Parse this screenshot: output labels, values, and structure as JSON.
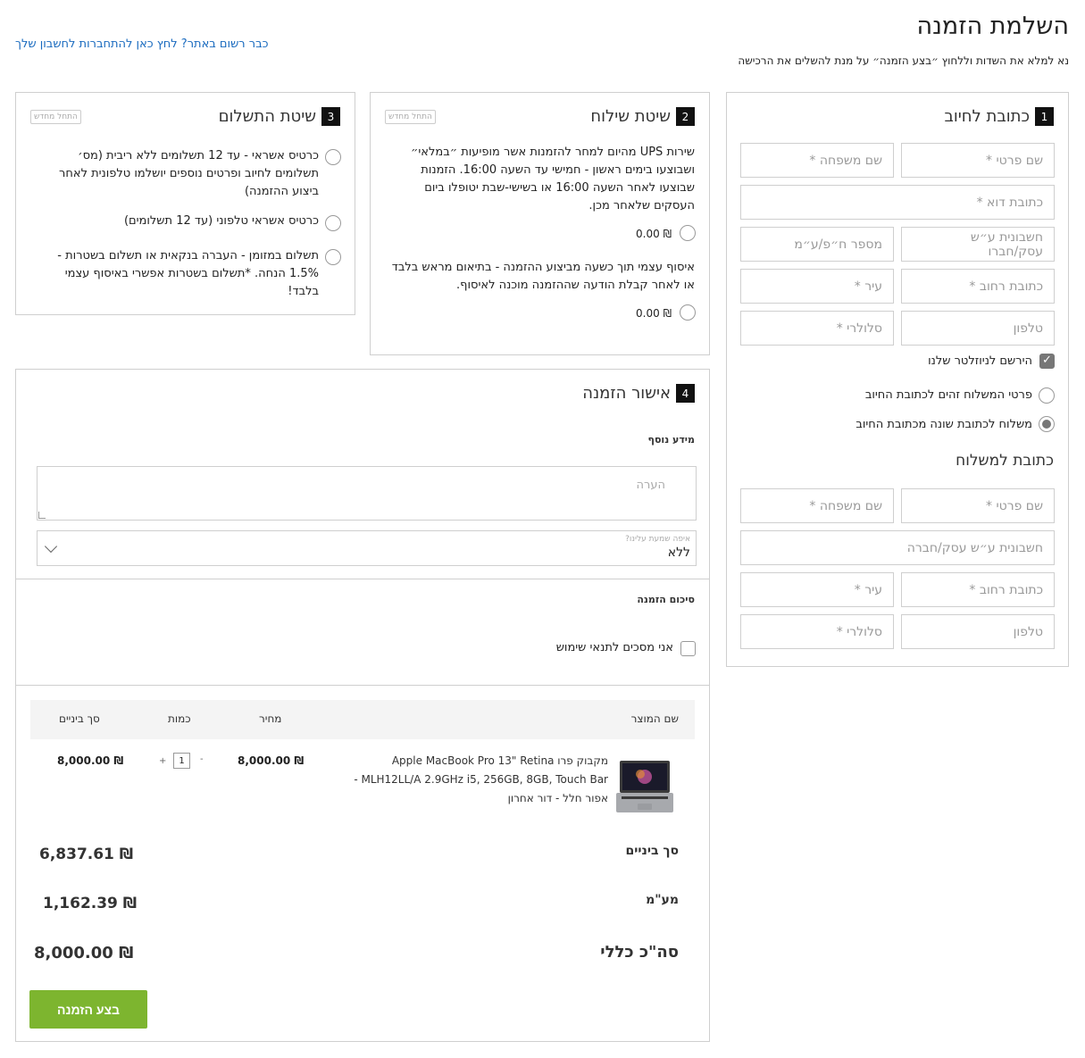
{
  "page": {
    "title": "השלמת הזמנה",
    "subtitle": "נא למלא את השדות וללחוץ ״בצע הזמנה״ על מנת להשלים את הרכישה",
    "login_link": "כבר רשום באתר? לחץ כאן להתחברות לחשבון שלך"
  },
  "billing": {
    "number": "1",
    "title": "כתובת לחיוב",
    "fields": {
      "first_name": "שם פרטי *",
      "last_name": "שם משפחה *",
      "email": "כתובת דוא *",
      "invoice_name": "חשבונית ע״ש עסק/חברו",
      "company_id": "מספר ח״פ/ע״מ",
      "street": "כתובת רחוב *",
      "city": "עיר *",
      "phone": "טלפון",
      "mobile": "סלולרי *"
    },
    "newsletter": "הירשם לניוזלטר שלנו",
    "newsletter_checked": true,
    "ship_same": "פרטי המשלוח זהים לכתובת החיוב",
    "ship_different": "משלוח לכתובת שונה מכתובת החיוב",
    "ship_choice": "different"
  },
  "shipping_address": {
    "title": "כתובת למשלוח",
    "fields": {
      "first_name": "שם פרטי *",
      "last_name": "שם משפחה *",
      "invoice_name": "חשבונית ע״ש עסק/חברה",
      "street": "כתובת רחוב *",
      "city": "עיר *",
      "phone": "טלפון",
      "mobile": "סלולרי *"
    }
  },
  "shipping_method": {
    "number": "2",
    "title": "שיטת שילוח",
    "reset": "התחל מחדש",
    "options": [
      {
        "text": "שירות UPS מהיום למחר להזמנות אשר מופיעות ״במלאי״ ושבוצעו בימים ראשון - חמישי עד השעה 16:00. הזמנות שבוצעו לאחר השעה 16:00 או בשישי-שבת יטופלו ביום העסקים שלאחר מכן.",
        "price": "₪ 0.00"
      },
      {
        "text": "איסוף עצמי תוך כשעה מביצוע ההזמנה - בתיאום מראש בלבד או לאחר קבלת הודעה שההזמנה מוכנה לאיסוף.",
        "price": "₪ 0.00"
      }
    ]
  },
  "payment": {
    "number": "3",
    "title": "שיטת התשלום",
    "reset": "התחל מחדש",
    "options": [
      "כרטיס אשראי - עד 12 תשלומים ללא ריבית (מס׳ תשלומים לחיוב ופרטים נוספים יושלמו טלפונית לאחר ביצוע ההזמנה)",
      "כרטיס אשראי טלפוני (עד 12 תשלומים)",
      "תשלום במזומן - העברה בנקאית או תשלום בשטרות - 1.5% הנחה. *תשלום בשטרות אפשרי באיסוף עצמי בלבד!"
    ]
  },
  "review": {
    "number": "4",
    "title": "אישור הזמנה",
    "extra_info": "מידע נוסף",
    "comment_placeholder": "הערה",
    "heard_label": "איפה שמעת עלינו?",
    "heard_value": "ללא",
    "summary_title": "סיכום הזמנה",
    "terms": "אני מסכים לתנאי שימוש"
  },
  "table": {
    "headers": {
      "product": "שם המוצר",
      "price": "מחיר",
      "qty": "כמות",
      "subtotal": "סך ביניים"
    },
    "rows": [
      {
        "name": "מקבוק פרו Apple MacBook Pro 13\" Retina MLH12LL/A 2.9GHz i5, 256GB, 8GB, Touch Bar - אפור חלל - דור אחרון",
        "price": "₪ 8,000.00",
        "qty": "1",
        "subtotal": "₪ 8,000.00",
        "image_icon": "laptop-icon"
      }
    ]
  },
  "totals": {
    "subtotal_label": "סך ביניים",
    "subtotal_value": "₪ 6,837.61",
    "vat_label": "מע\"מ",
    "vat_value": "₪ 1,162.39",
    "total_label": "סה\"כ כללי",
    "total_value": "₪ 8,000.00"
  },
  "place_order": "בצע הזמנה",
  "colors": {
    "accent_green": "#7db52f",
    "link_blue": "#1a6bbf",
    "border": "#cfcfcf"
  }
}
